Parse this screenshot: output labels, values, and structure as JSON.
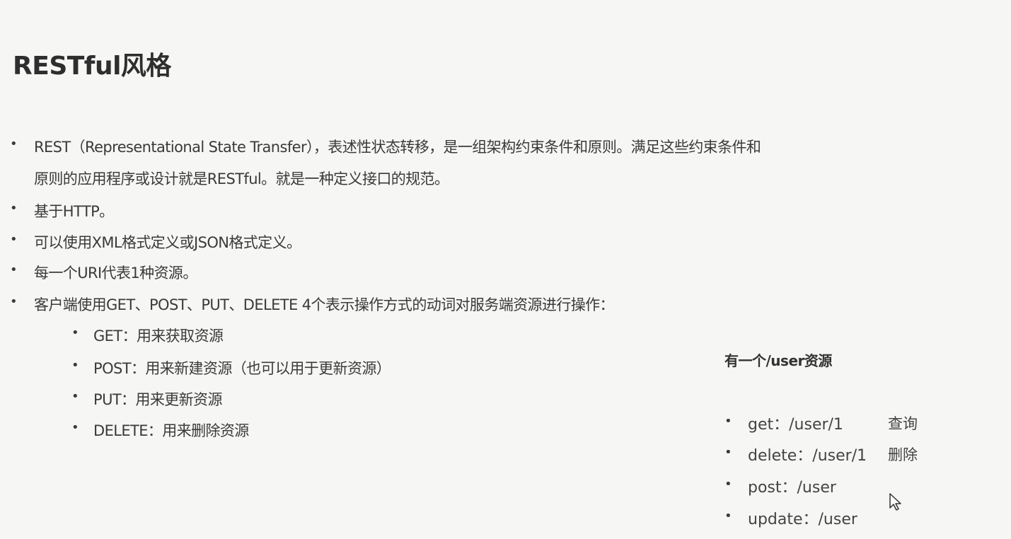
{
  "title": "RESTful风格",
  "bullets": [
    "REST（Representational State Transfer），表述性状态转移，是一组架构约束条件和原则。满足这些约束条件和",
    "原则的应用程序或设计就是RESTful。就是一种定义接口的规范。",
    "基于HTTP。",
    "可以使用XML格式定义或JSON格式定义。",
    "每一个URI代表1种资源。",
    "客户端使用GET、POST、PUT、DELETE 4个表示操作方式的动词对服务端资源进行操作："
  ],
  "sub_bullets": [
    "GET：用来获取资源",
    "POST：用来新建资源（也可以用于更新资源）",
    "PUT：用来更新资源",
    "DELETE：用来删除资源"
  ],
  "example": {
    "heading": "有一个/user资源",
    "items": [
      {
        "text": "get：/user/1",
        "note": "查询"
      },
      {
        "text": "delete：/user/1",
        "note": "删除"
      },
      {
        "text": "post：/user",
        "note": ""
      },
      {
        "text": "update：/user",
        "note": ""
      }
    ]
  }
}
